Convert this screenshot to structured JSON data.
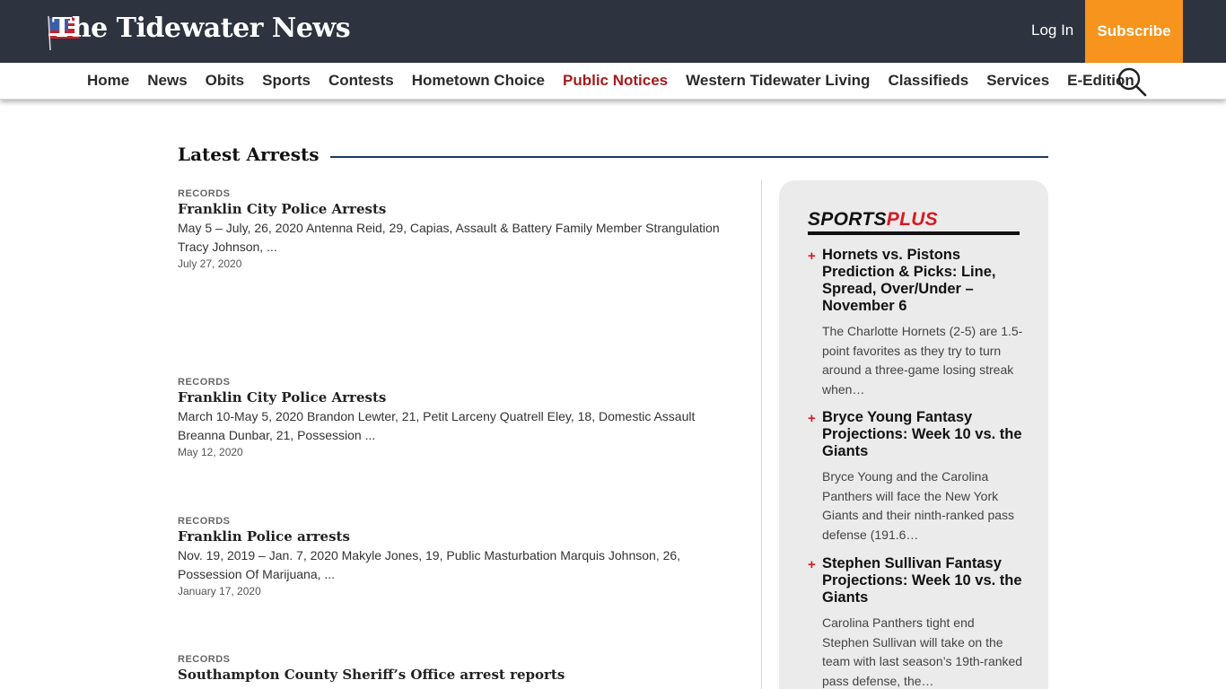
{
  "header": {
    "logo_text": "The Tidewater News",
    "login_label": "Log In",
    "subscribe_label": "Subscribe"
  },
  "nav": {
    "items": [
      {
        "label": "Home"
      },
      {
        "label": "News"
      },
      {
        "label": "Obits"
      },
      {
        "label": "Sports"
      },
      {
        "label": "Contests"
      },
      {
        "label": "Hometown Choice"
      },
      {
        "label": "Public Notices"
      },
      {
        "label": "Western Tidewater Living"
      },
      {
        "label": "Classifieds"
      },
      {
        "label": "Services"
      },
      {
        "label": "E-Edition"
      }
    ],
    "active": "Public Notices",
    "search_icon": "search-icon"
  },
  "main": {
    "section_title": "Latest Arrests",
    "articles": [
      {
        "category": "RECORDS",
        "headline": "Franklin City Police Arrests",
        "excerpt": "May 5 – July, 26, 2020 Antenna Reid, 29, Capias, Assault & Battery Family Member Strangulation Tracy Johnson, ...",
        "date": "July 27, 2020"
      },
      {
        "category": "RECORDS",
        "headline": "Franklin City Police Arrests",
        "excerpt": "March 10-May 5, 2020 Brandon Lewter, 21, Petit Larceny Quatrell Eley, 18, Domestic Assault Breanna Dunbar, 21, Possession ...",
        "date": "May 12, 2020"
      },
      {
        "category": "RECORDS",
        "headline": "Franklin Police arrests",
        "excerpt": "Nov. 19, 2019 – Jan. 7, 2020 Makyle Jones, 19, Public Masturbation Marquis Johnson, 26, Possession Of Marijuana, ...",
        "date": "January 17, 2020"
      },
      {
        "category": "RECORDS",
        "headline": "Southampton County Sheriff’s Office arrest reports"
      }
    ]
  },
  "sidebar": {
    "title_part1": "SPORTS",
    "title_part2": "PLUS",
    "items": [
      {
        "headline": "Hornets vs. Pistons Prediction & Picks: Line, Spread, Over/Under – November 6",
        "text": "The Charlotte Hornets (2-5) are 1.5-point favorites as they try to turn around a three-game losing streak when…"
      },
      {
        "headline": "Bryce Young Fantasy Projections: Week 10 vs. the Giants",
        "text": "Bryce Young and the Carolina Panthers will face the New York Giants and their ninth-ranked pass defense (191.6…"
      },
      {
        "headline": "Stephen Sullivan Fantasy Projections: Week 10 vs. the Giants",
        "text": "Carolina Panthers tight end Stephen Sullivan will take on the team with last season’s 19th-ranked pass defense, the…"
      }
    ],
    "plus_symbol": "+"
  },
  "colors": {
    "topbar": "#2d333f",
    "subscribe": "#f7941d",
    "active_nav": "#a51c1c",
    "accent_red": "#d71920",
    "rule_blue": "#1f3a5f"
  }
}
